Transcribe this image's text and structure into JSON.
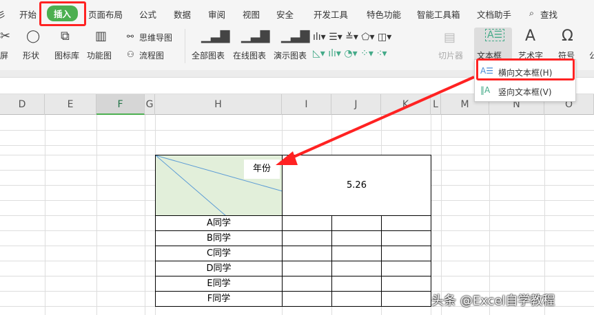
{
  "tabs": [
    "开始",
    "插入",
    "页面布局",
    "公式",
    "数据",
    "审阅",
    "视图",
    "安全",
    "开发工具",
    "特色功能",
    "智能工具箱",
    "文档助手",
    "查找"
  ],
  "ribbon": {
    "screenshot": "屏",
    "shape": "形状",
    "icon_lib": "图标库",
    "func_chart": "功能图",
    "mindmap": "思维导图",
    "flowchart": "流程图",
    "all_charts": "全部图表",
    "online_charts": "在线图表",
    "demo_charts": "演示图表",
    "slicer": "切片器",
    "textbox": "文本框",
    "wordart": "艺术字",
    "symbol": "符号",
    "formula": "公"
  },
  "dropdown": {
    "horizontal": "横向文本框(H)",
    "vertical": "竖向文本框(V)"
  },
  "columns": [
    "D",
    "E",
    "F",
    "G",
    "H",
    "I",
    "J",
    "K",
    "L",
    "M",
    "N",
    "O"
  ],
  "table": {
    "corner_label": "年份",
    "header_value": "5.26",
    "rows": [
      "A同学",
      "B同学",
      "C同学",
      "D同学",
      "E同学",
      "F同学"
    ]
  },
  "watermark": "头条 @Excel自学教程"
}
